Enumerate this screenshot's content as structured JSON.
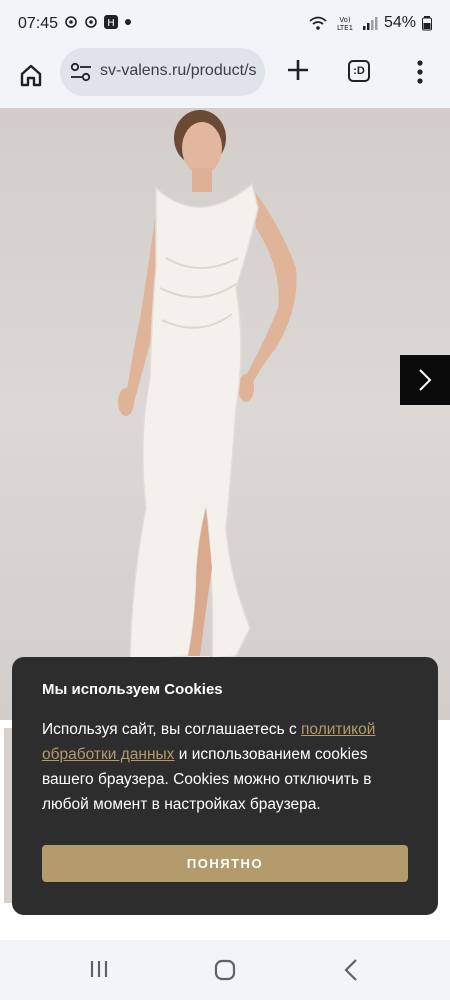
{
  "status_bar": {
    "time": "07:45",
    "battery": "54%",
    "network": "Vo) LTE1"
  },
  "browser": {
    "url": "sv-valens.ru/product/s",
    "tabs_icon": ":D"
  },
  "cookie_banner": {
    "title": "Мы используем Cookies",
    "text_before_link": "Используя сайт, вы соглашаетесь с ",
    "link_text": "политикой обработки данных",
    "text_after_link": " и использованием cookies вашего браузера. Cookies можно отключить в любой момент в настройках браузера.",
    "button_label": "ПОНЯТНО"
  },
  "colors": {
    "accent": "#b39b6b",
    "banner_bg": "#2d2d2d",
    "chrome_bg": "#f2f4f8"
  },
  "icons": {
    "home": "home-icon",
    "site_settings": "site-settings-icon",
    "new_tab": "plus-icon",
    "menu": "more-vertical-icon",
    "next": "chevron-right-icon",
    "nav_recents": "recents-icon",
    "nav_home": "nav-home-icon",
    "nav_back": "back-icon"
  }
}
